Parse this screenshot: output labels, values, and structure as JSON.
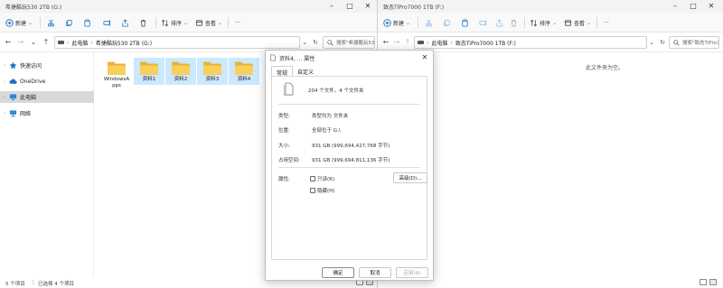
{
  "left_window": {
    "title": "希捷酷玩530 2TB (G:)",
    "toolbar": {
      "new_label": "新建",
      "sort_label": "排序",
      "view_label": "查看",
      "more_label": "···"
    },
    "path": [
      "此电脑",
      "希捷酷玩530 2TB (G:)"
    ],
    "search_placeholder": "搜索\"希捷酷玩530 2...\"",
    "nav": [
      {
        "label": "快速访问",
        "icon": "star-icon"
      },
      {
        "label": "OneDrive",
        "icon": "cloud-icon"
      },
      {
        "label": "此电脑",
        "icon": "computer-icon"
      },
      {
        "label": "网络",
        "icon": "network-icon"
      }
    ],
    "files": [
      {
        "name": "WindowsApps",
        "name_line1": "WindowsA",
        "name_line2": "pps",
        "selected": false
      },
      {
        "name": "资料1",
        "selected": true
      },
      {
        "name": "资料2",
        "selected": true
      },
      {
        "name": "资料3",
        "selected": true
      },
      {
        "name": "资料4",
        "selected": true
      }
    ],
    "status": {
      "count": "5 个项目",
      "selected": "已选择 4 个项目"
    }
  },
  "right_window": {
    "title": "致态TiPro7000 1TB (F:)",
    "toolbar": {
      "new_label": "新建",
      "sort_label": "排序",
      "view_label": "查看",
      "more_label": "···"
    },
    "path": [
      "此电脑",
      "致态TiPro7000 1TB (F:)"
    ],
    "search_placeholder": "搜索\"致态TiPro7000 1T...\"",
    "empty_message": "此文件夹为空。"
  },
  "dialog": {
    "title": "资料4, ... 属性",
    "tabs": [
      "常规",
      "自定义"
    ],
    "summary": "204 个文件，4 个文件夹",
    "type_label": "类型:",
    "type_value": "类型均为 文件夹",
    "location_label": "位置:",
    "location_value": "全部位于 G:\\",
    "size_label": "大小:",
    "size_value": "931 GB (999,694,427,768 字节)",
    "disk_label": "占用空间:",
    "disk_value": "931 GB (999,694,811,136 字节)",
    "attr_label": "属性:",
    "readonly_label": "只读(R)",
    "hidden_label": "隐藏(H)",
    "advanced_label": "高级(D)...",
    "ok_label": "确定",
    "cancel_label": "取消",
    "apply_label": "应用(A)"
  },
  "colors": {
    "folder": "#f5c542",
    "selection": "#cce8ff",
    "nav_selected": "#d9d9d9"
  }
}
